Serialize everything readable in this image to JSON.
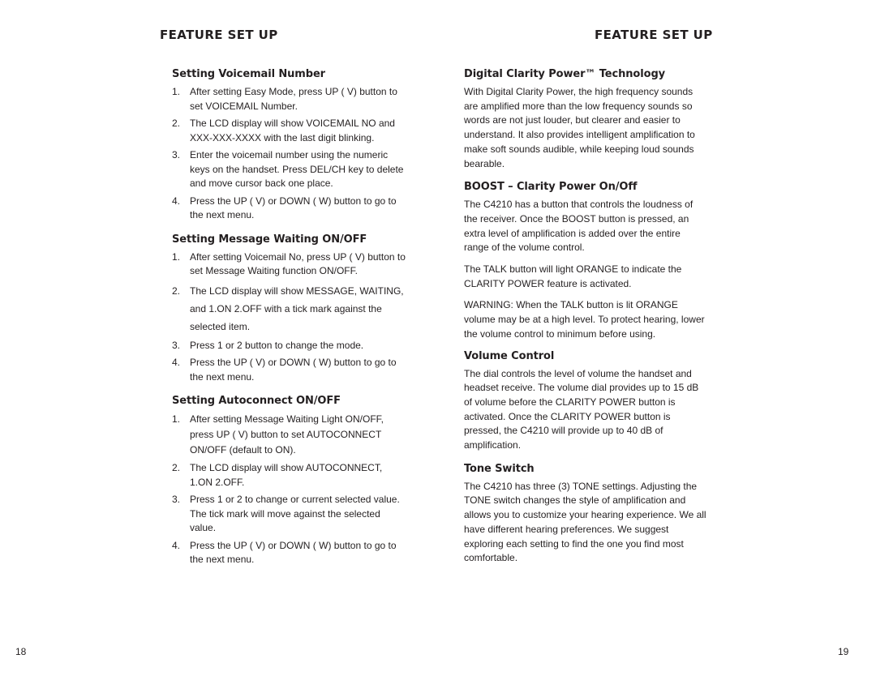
{
  "left_page": {
    "header": "FEATURE SET UP",
    "page_number": "18",
    "sections": [
      {
        "title": "Setting Voicemail Number",
        "steps": [
          {
            "num": "1.",
            "text": "After setting Easy Mode, press UP ( V) button to set VOICEMAIL Number."
          },
          {
            "num": "2.",
            "text": "The LCD display will show VOICEMAIL NO and XXX-XXX-XXXX with the last digit blinking."
          },
          {
            "num": "3.",
            "text": "Enter the voicemail number using the numeric keys on the handset. Press DEL/CH key to delete and move cursor back one place."
          },
          {
            "num": "4.",
            "text": "Press the UP ( V) or DOWN ( W) button to go to the next menu."
          }
        ]
      },
      {
        "title": "Setting Message Waiting ON/OFF",
        "steps": [
          {
            "num": "1.",
            "text": "After setting Voicemail No, press UP ( V) button to set Message Waiting function ON/OFF."
          },
          {
            "num": "2.",
            "text": "The LCD display will show MESSAGE, WAITING, and 1.ON  2.OFF with a tick mark against the selected item."
          },
          {
            "num": "3.",
            "text": "Press 1 or 2 button to change the mode."
          },
          {
            "num": "4.",
            "text": "Press the UP ( V) or DOWN ( W) button to go to the next menu."
          }
        ]
      },
      {
        "title": "Setting Autoconnect ON/OFF",
        "steps": [
          {
            "num": "1.",
            "text": "After setting Message Waiting Light ON/OFF, press UP ( V) button to set AUTOCONNECT ON/OFF (default to ON)."
          },
          {
            "num": "2.",
            "text": "The LCD display will show AUTOCONNECT, 1.ON   2.OFF."
          },
          {
            "num": "3.",
            "text": "Press 1 or 2 to change or current selected value. The tick mark will move against the selected value."
          },
          {
            "num": "4.",
            "text": "Press the UP ( V) or DOWN ( W) button to go to the next menu."
          }
        ]
      }
    ]
  },
  "right_page": {
    "header": "FEATURE SET UP",
    "page_number": "19",
    "sections": [
      {
        "title": "Digital Clarity Power™ Technology",
        "paragraphs": [
          "With Digital Clarity Power, the high frequency sounds are amplified more than the low frequency sounds so words are not just louder, but clearer and easier to understand.  It also provides intelligent amplification to make soft sounds audible, while keeping loud sounds bearable."
        ]
      },
      {
        "title": "BOOST – Clarity Power On/Off",
        "paragraphs": [
          "The C4210 has a button that controls the loudness of the receiver. Once the BOOST button is pressed, an extra level of amplification is added over the entire range of the volume control.",
          "The TALK button will light ORANGE to indicate the CLARITY POWER feature is activated.",
          "WARNING: When the TALK button is lit ORANGE volume may be at a high level. To protect hearing, lower the volume control to minimum before using."
        ]
      },
      {
        "title": "Volume Control",
        "paragraphs": [
          "The dial controls the level of volume the handset and headset receive. The volume dial provides up to 15 dB of volume before the CLARITY POWER button is activated. Once the CLARITY POWER button is pressed, the C4210 will provide up to 40 dB of amplification."
        ]
      },
      {
        "title": "Tone Switch",
        "paragraphs": [
          "The C4210 has three (3) TONE settings.  Adjusting the TONE switch changes the style of amplification and allows you to customize your hearing experience. We all have different hearing preferences. We suggest exploring each setting to find the one you find most comfortable."
        ]
      }
    ]
  }
}
